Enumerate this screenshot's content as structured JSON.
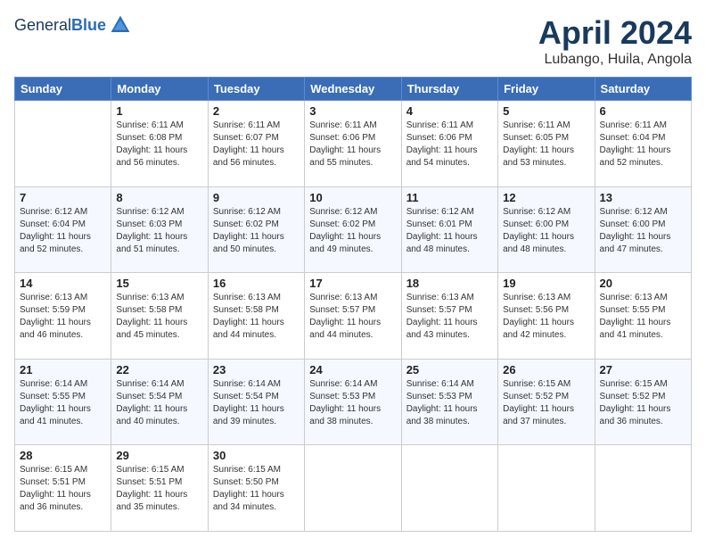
{
  "header": {
    "logo_general": "General",
    "logo_blue": "Blue",
    "month_title": "April 2024",
    "location": "Lubango, Huila, Angola"
  },
  "calendar": {
    "days_of_week": [
      "Sunday",
      "Monday",
      "Tuesday",
      "Wednesday",
      "Thursday",
      "Friday",
      "Saturday"
    ],
    "weeks": [
      [
        {
          "day": "",
          "info": ""
        },
        {
          "day": "1",
          "info": "Sunrise: 6:11 AM\nSunset: 6:08 PM\nDaylight: 11 hours\nand 56 minutes."
        },
        {
          "day": "2",
          "info": "Sunrise: 6:11 AM\nSunset: 6:07 PM\nDaylight: 11 hours\nand 56 minutes."
        },
        {
          "day": "3",
          "info": "Sunrise: 6:11 AM\nSunset: 6:06 PM\nDaylight: 11 hours\nand 55 minutes."
        },
        {
          "day": "4",
          "info": "Sunrise: 6:11 AM\nSunset: 6:06 PM\nDaylight: 11 hours\nand 54 minutes."
        },
        {
          "day": "5",
          "info": "Sunrise: 6:11 AM\nSunset: 6:05 PM\nDaylight: 11 hours\nand 53 minutes."
        },
        {
          "day": "6",
          "info": "Sunrise: 6:11 AM\nSunset: 6:04 PM\nDaylight: 11 hours\nand 52 minutes."
        }
      ],
      [
        {
          "day": "7",
          "info": "Sunrise: 6:12 AM\nSunset: 6:04 PM\nDaylight: 11 hours\nand 52 minutes."
        },
        {
          "day": "8",
          "info": "Sunrise: 6:12 AM\nSunset: 6:03 PM\nDaylight: 11 hours\nand 51 minutes."
        },
        {
          "day": "9",
          "info": "Sunrise: 6:12 AM\nSunset: 6:02 PM\nDaylight: 11 hours\nand 50 minutes."
        },
        {
          "day": "10",
          "info": "Sunrise: 6:12 AM\nSunset: 6:02 PM\nDaylight: 11 hours\nand 49 minutes."
        },
        {
          "day": "11",
          "info": "Sunrise: 6:12 AM\nSunset: 6:01 PM\nDaylight: 11 hours\nand 48 minutes."
        },
        {
          "day": "12",
          "info": "Sunrise: 6:12 AM\nSunset: 6:00 PM\nDaylight: 11 hours\nand 48 minutes."
        },
        {
          "day": "13",
          "info": "Sunrise: 6:12 AM\nSunset: 6:00 PM\nDaylight: 11 hours\nand 47 minutes."
        }
      ],
      [
        {
          "day": "14",
          "info": "Sunrise: 6:13 AM\nSunset: 5:59 PM\nDaylight: 11 hours\nand 46 minutes."
        },
        {
          "day": "15",
          "info": "Sunrise: 6:13 AM\nSunset: 5:58 PM\nDaylight: 11 hours\nand 45 minutes."
        },
        {
          "day": "16",
          "info": "Sunrise: 6:13 AM\nSunset: 5:58 PM\nDaylight: 11 hours\nand 44 minutes."
        },
        {
          "day": "17",
          "info": "Sunrise: 6:13 AM\nSunset: 5:57 PM\nDaylight: 11 hours\nand 44 minutes."
        },
        {
          "day": "18",
          "info": "Sunrise: 6:13 AM\nSunset: 5:57 PM\nDaylight: 11 hours\nand 43 minutes."
        },
        {
          "day": "19",
          "info": "Sunrise: 6:13 AM\nSunset: 5:56 PM\nDaylight: 11 hours\nand 42 minutes."
        },
        {
          "day": "20",
          "info": "Sunrise: 6:13 AM\nSunset: 5:55 PM\nDaylight: 11 hours\nand 41 minutes."
        }
      ],
      [
        {
          "day": "21",
          "info": "Sunrise: 6:14 AM\nSunset: 5:55 PM\nDaylight: 11 hours\nand 41 minutes."
        },
        {
          "day": "22",
          "info": "Sunrise: 6:14 AM\nSunset: 5:54 PM\nDaylight: 11 hours\nand 40 minutes."
        },
        {
          "day": "23",
          "info": "Sunrise: 6:14 AM\nSunset: 5:54 PM\nDaylight: 11 hours\nand 39 minutes."
        },
        {
          "day": "24",
          "info": "Sunrise: 6:14 AM\nSunset: 5:53 PM\nDaylight: 11 hours\nand 38 minutes."
        },
        {
          "day": "25",
          "info": "Sunrise: 6:14 AM\nSunset: 5:53 PM\nDaylight: 11 hours\nand 38 minutes."
        },
        {
          "day": "26",
          "info": "Sunrise: 6:15 AM\nSunset: 5:52 PM\nDaylight: 11 hours\nand 37 minutes."
        },
        {
          "day": "27",
          "info": "Sunrise: 6:15 AM\nSunset: 5:52 PM\nDaylight: 11 hours\nand 36 minutes."
        }
      ],
      [
        {
          "day": "28",
          "info": "Sunrise: 6:15 AM\nSunset: 5:51 PM\nDaylight: 11 hours\nand 36 minutes."
        },
        {
          "day": "29",
          "info": "Sunrise: 6:15 AM\nSunset: 5:51 PM\nDaylight: 11 hours\nand 35 minutes."
        },
        {
          "day": "30",
          "info": "Sunrise: 6:15 AM\nSunset: 5:50 PM\nDaylight: 11 hours\nand 34 minutes."
        },
        {
          "day": "",
          "info": ""
        },
        {
          "day": "",
          "info": ""
        },
        {
          "day": "",
          "info": ""
        },
        {
          "day": "",
          "info": ""
        }
      ]
    ]
  }
}
